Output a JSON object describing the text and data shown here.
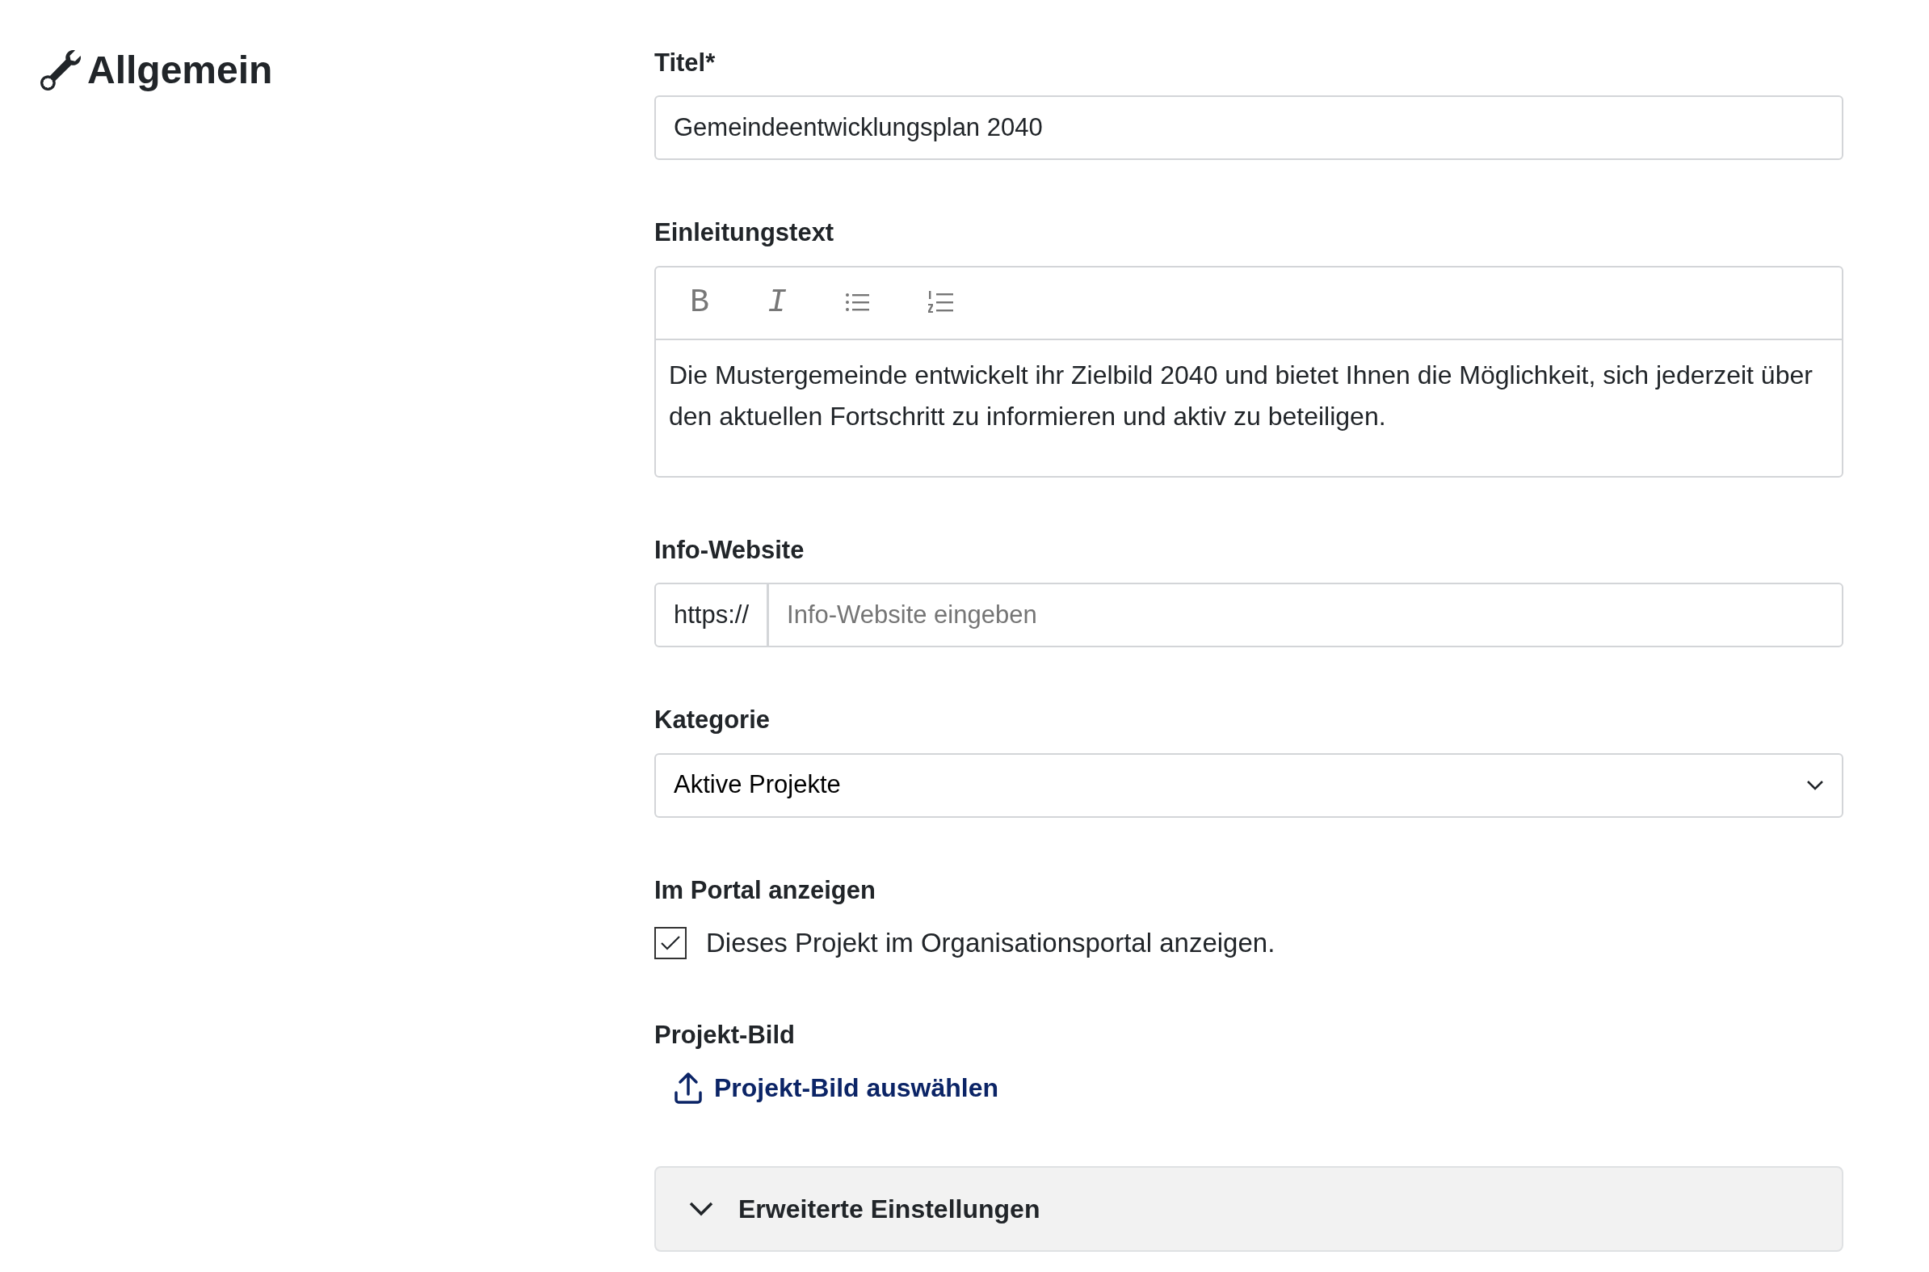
{
  "section": {
    "title": "Allgemein"
  },
  "fields": [
    {
      "kind": "text",
      "label": "Titel*",
      "value": "Gemeindeentwicklungsplan 2040"
    },
    {
      "kind": "richtext",
      "label": "Einleitungstext",
      "toolbar": [
        {
          "kind": "bold",
          "text": "B"
        },
        {
          "kind": "italic",
          "text": "I"
        },
        {
          "kind": "bullet_list"
        },
        {
          "kind": "ordered_list"
        }
      ],
      "value": "Die Mustergemeinde entwickelt ihr Zielbild 2040 und bietet Ihnen die Möglichkeit, sich jederzeit über den aktuellen Fortschritt zu informieren und aktiv zu beteiligen."
    },
    {
      "kind": "url",
      "label": "Info-Website",
      "prefix": "https://",
      "placeholder": "Info-Website eingeben"
    },
    {
      "kind": "select",
      "label": "Kategorie",
      "value": "Aktive Projekte"
    },
    {
      "kind": "checkbox",
      "label": "Im Portal anzeigen",
      "text": "Dieses Projekt im Organisationsportal anzeigen.",
      "checked": true
    },
    {
      "kind": "upload",
      "label": "Projekt-Bild",
      "link": "Projekt-Bild auswählen"
    }
  ],
  "accordion": {
    "title": "Erweiterte Einstellungen",
    "expanded": false
  }
}
